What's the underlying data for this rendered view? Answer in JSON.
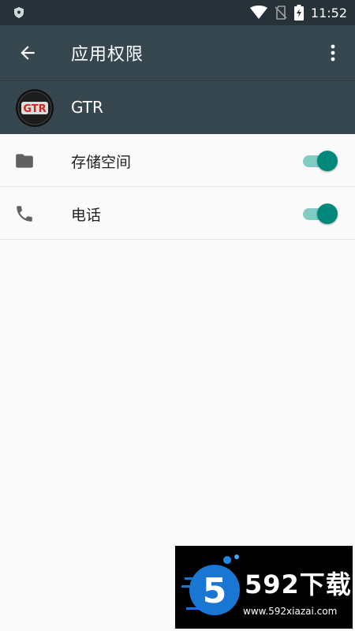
{
  "status_bar": {
    "time": "11:52",
    "icons": [
      "shield-icon",
      "wifi-icon",
      "no-sim-icon",
      "battery-charging-icon"
    ]
  },
  "app_bar": {
    "back_icon": "arrow-back-icon",
    "title": "应用权限",
    "overflow_icon": "more-vert-icon"
  },
  "app": {
    "name": "GTR",
    "logo_text": "GTR"
  },
  "permissions": [
    {
      "label": "存储空间",
      "icon": "folder-icon",
      "enabled": true
    },
    {
      "label": "电话",
      "icon": "phone-icon",
      "enabled": true
    }
  ],
  "watermark": {
    "brand": "592下载",
    "url": "www.592xiazai.com",
    "logo_digit": "5"
  },
  "colors": {
    "status_bar": "#263238",
    "app_bar": "#37474f",
    "toggle_thumb": "#00897b",
    "toggle_track": "#80cbc4",
    "background": "#fafafa"
  }
}
